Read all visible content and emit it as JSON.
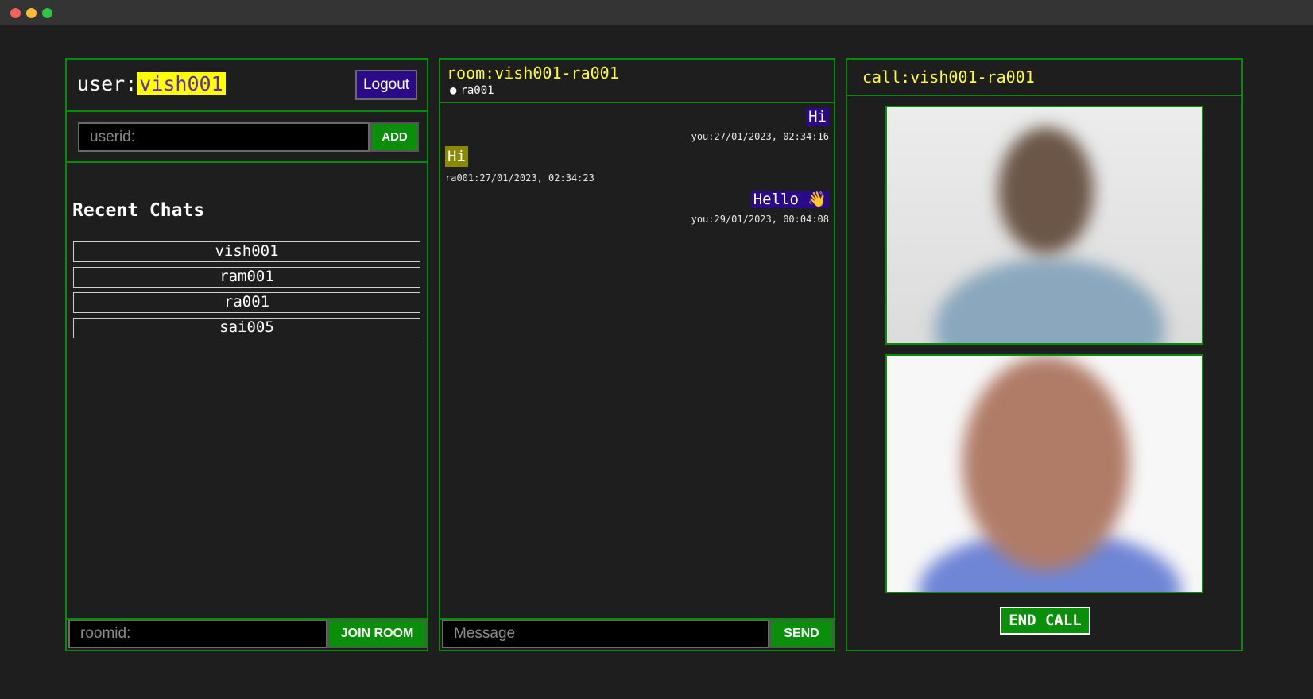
{
  "window": {
    "controls": [
      "close",
      "minimize",
      "maximize"
    ]
  },
  "user": {
    "label": "user:",
    "name": "vish001",
    "logout_label": "Logout"
  },
  "add_user": {
    "placeholder": "userid:",
    "button_label": "ADD"
  },
  "recent": {
    "title": "Recent Chats",
    "items": [
      "vish001",
      "ram001",
      "ra001",
      "sai005"
    ]
  },
  "join": {
    "placeholder": "roomid:",
    "button_label": "JOIN ROOM"
  },
  "room": {
    "title": "room:vish001-ra001",
    "member": "ra001",
    "messages": [
      {
        "text": "Hi",
        "meta": "you:27/01/2023, 02:34:16",
        "from": "you"
      },
      {
        "text": "Hi",
        "meta": "ra001:27/01/2023, 02:34:23",
        "from": "other"
      },
      {
        "text": "Hello 👋",
        "meta": "you:29/01/2023, 00:04:08",
        "from": "you"
      }
    ],
    "input_placeholder": "Message",
    "send_label": "SEND"
  },
  "call": {
    "title": "call:vish001-ra001",
    "end_label": "END CALL"
  },
  "colors": {
    "accent_green": "#0a8a0a",
    "highlight_yellow": "#ffff00",
    "button_purple": "#2b0a8a",
    "bubble_other": "#8a8a00"
  }
}
